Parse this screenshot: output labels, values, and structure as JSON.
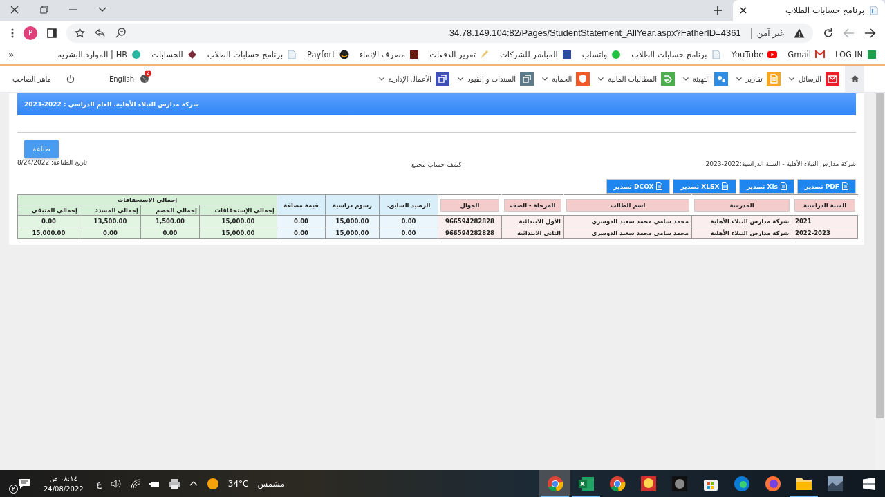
{
  "tab": {
    "title": "برنامج حسابات الطلاب"
  },
  "address_bar": {
    "security": "غير آمن",
    "url": "34.78.149.104:82/Pages/StudentStatement_AllYear.aspx?FatherID=4361",
    "profile": "P"
  },
  "bookmarks": [
    {
      "label": "LOG-IN"
    },
    {
      "label": "Gmail"
    },
    {
      "label": "YouTube"
    },
    {
      "label": "برنامج حسابات الطلاب"
    },
    {
      "label": "واتساب"
    },
    {
      "label": "المباشر للشركات"
    },
    {
      "label": "تقرير الدفعات"
    },
    {
      "label": "مصرف الإنماء"
    },
    {
      "label": "Payfort"
    },
    {
      "label": "برنامج حسابات الطلاب"
    },
    {
      "label": "الحسابات"
    },
    {
      "label": "الموارد البشريه | HR"
    }
  ],
  "bookmarks_overflow": "»",
  "nav": {
    "items": [
      {
        "label": "الرسائل",
        "color": "#e8202a"
      },
      {
        "label": "تقارير",
        "color": "#f5a623"
      },
      {
        "label": "التهيئة",
        "color": "#2f8de4"
      },
      {
        "label": "المطالبات المالية",
        "color": "#4cae4c"
      },
      {
        "label": "الحماية",
        "color": "#f05a28"
      },
      {
        "label": "السندات و القيود",
        "color": "#5d7b8a"
      },
      {
        "label": "الأعمال الإدارية",
        "color": "#3f51b5"
      }
    ],
    "language": "English",
    "notifications": "2",
    "user": "ماهر الصاحب"
  },
  "report": {
    "banner": "شركة مدارس النبلاء الأهلية. العام الدراسي : 2022-2023",
    "print_button": "طباعة",
    "print_date": "تاريخ الطباعة: 8/24/2022",
    "title": "كشف حساب مجمع",
    "subtitle": "شركة مدارس النبلاء الأهلية  - السنة الدراسية:2022-2023",
    "exports": [
      "تصدير PDF",
      "تصدير Xls",
      "تصدير XLSX",
      "تصدير DCOX"
    ]
  },
  "table": {
    "group_label": "إجمالي الإستحقاقات",
    "columns": [
      {
        "label": "السنة الدراسية",
        "kind": "student"
      },
      {
        "label": "المدرسة",
        "kind": "student"
      },
      {
        "label": "اسم الطالب",
        "kind": "student"
      },
      {
        "label": "المرحلة - الصف",
        "kind": "student"
      },
      {
        "label": "الجوال",
        "kind": "student"
      },
      {
        "label": "الرصيد السابق.",
        "kind": "fee"
      },
      {
        "label": "رسوم دراسية",
        "kind": "fee"
      },
      {
        "label": "قيمة مضافة",
        "kind": "fee"
      },
      {
        "label": "إجمالي الإستحقاقات",
        "kind": "total"
      },
      {
        "label": "إجمالي الخصم",
        "kind": "total"
      },
      {
        "label": "إجمالي المسدد",
        "kind": "total"
      },
      {
        "label": "إجمالي المتبقي",
        "kind": "total"
      }
    ],
    "rows": [
      [
        "2021",
        "شركة مدارس النبلاء الأهلية",
        "محمد سامي محمد سعيد الدوسري",
        "الأول الابتدائية",
        "966594282828",
        "0.00",
        "15,000.00",
        "0.00",
        "15,000.00",
        "1,500.00",
        "13,500.00",
        "0.00"
      ],
      [
        "2022-2023",
        "شركة مدارس النبلاء الأهلية",
        "محمد سامي محمد سعيد الدوسري",
        "الثاني الابتدائية",
        "966594282828",
        "0.00",
        "15,000.00",
        "0.00",
        "15,000.00",
        "0.00",
        "0.00",
        "15,000.00"
      ]
    ]
  },
  "taskbar": {
    "notification_count": "٢",
    "time": "٠٨:١٤ ص",
    "date": "24/08/2022",
    "input_language": "ع",
    "temperature": "34°C",
    "weather": "مشمس",
    "apps": [
      {
        "selected": true,
        "running": true
      },
      {
        "selected": false,
        "running": true
      },
      {
        "selected": false,
        "running": false
      },
      {
        "selected": false,
        "running": false
      },
      {
        "selected": false,
        "running": false
      },
      {
        "selected": false,
        "running": false
      },
      {
        "selected": false,
        "running": false
      },
      {
        "selected": false,
        "running": false
      },
      {
        "selected": false,
        "running": true
      },
      {
        "selected": false,
        "running": false
      }
    ]
  }
}
